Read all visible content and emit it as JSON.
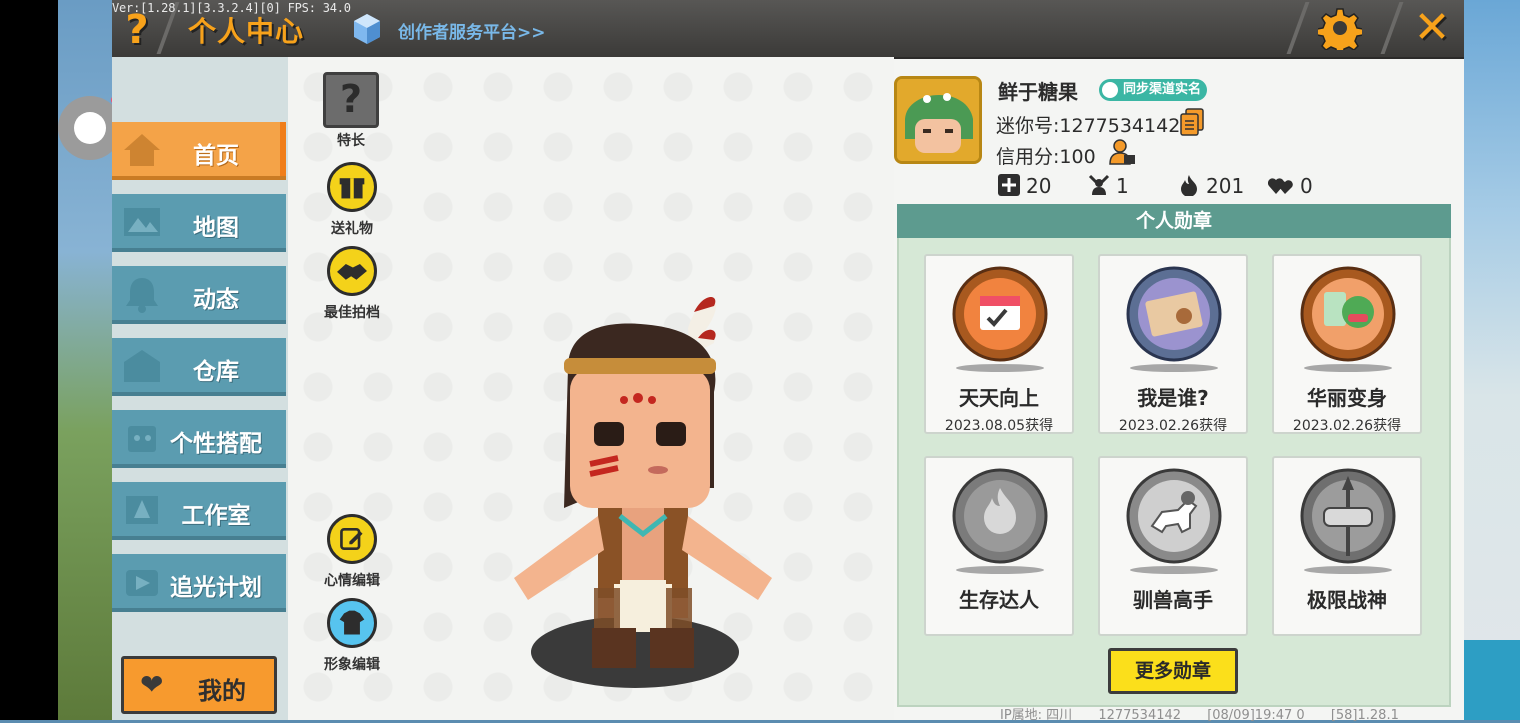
{
  "debug": {
    "version_text": "Ver:[1.28.1][3.3.2.4][0] FPS: 34.0"
  },
  "header": {
    "help_label": "?",
    "title": "个人中心",
    "creator_link": "创作者服务平台>>",
    "close_label": "✕"
  },
  "sidebar": {
    "items": [
      {
        "label": "首页",
        "icon": "house-icon",
        "active": true
      },
      {
        "label": "地图",
        "icon": "map-icon",
        "active": false
      },
      {
        "label": "动态",
        "icon": "bell-icon",
        "active": false
      },
      {
        "label": "仓库",
        "icon": "warehouse-icon",
        "active": false
      },
      {
        "label": "个性搭配",
        "icon": "outfit-icon",
        "active": false
      },
      {
        "label": "工作室",
        "icon": "studio-icon",
        "active": false
      },
      {
        "label": "追光计划",
        "icon": "spotlight-icon",
        "active": false
      }
    ],
    "my_button": "我的"
  },
  "actions": {
    "talent": {
      "label": "特长",
      "glyph": "?"
    },
    "gift": {
      "label": "送礼物"
    },
    "partner": {
      "label": "最佳拍档"
    },
    "mood": {
      "label": "心情编辑"
    },
    "appearance": {
      "label": "形象编辑"
    }
  },
  "profile": {
    "name": "鲜于糖果",
    "verify_badge": "同步渠道实名",
    "uid_text": "迷你号:1277534142",
    "credit_text": "信用分:100",
    "stats": [
      {
        "icon": "plus-square-icon",
        "value": "20"
      },
      {
        "icon": "fan-icon",
        "value": "1"
      },
      {
        "icon": "flame-icon",
        "value": "201"
      },
      {
        "icon": "hearts-icon",
        "value": "0"
      }
    ]
  },
  "medals": {
    "title": "个人勋章",
    "items": [
      {
        "name": "天天向上",
        "date": "2023.08.05获得",
        "style": "bronze"
      },
      {
        "name": "我是谁?",
        "date": "2023.02.26获得",
        "style": "silver-blue"
      },
      {
        "name": "华丽变身",
        "date": "2023.02.26获得",
        "style": "bronze"
      },
      {
        "name": "生存达人",
        "date": "",
        "style": "gray"
      },
      {
        "name": "驯兽高手",
        "date": "",
        "style": "gray"
      },
      {
        "name": "极限战神",
        "date": "",
        "style": "gray"
      }
    ],
    "more_button": "更多勋章"
  },
  "footer": {
    "ip_location": "IP属地: 四川",
    "uid": "1277534142",
    "timestamp": "[08/09]19:47 0",
    "build": "[58]1.28.1"
  },
  "colors": {
    "accent_orange": "#f7a21b",
    "nav_blue": "#5b9cb0",
    "nav_active": "#f4a348",
    "medal_header": "#5d9b8f",
    "more_button": "#fbdf1b"
  }
}
